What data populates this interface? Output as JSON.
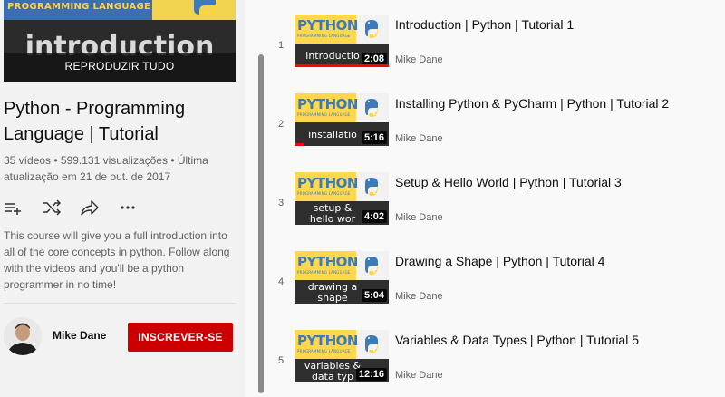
{
  "playlist": {
    "hero_band_text": "PROGRAMMING LANGUAGE",
    "hero_word": "introduction",
    "play_all_label": "REPRODUZIR TUDO",
    "title": "Python - Programming Language | Tutorial",
    "stats": "35 vídeos • 599.131 visualizações • Última atualização em 21 de out. de 2017",
    "description": "This course will give you a full introduction into all of the core concepts in python. Follow along with the videos and you'll be a python programmer in no time!",
    "actions": [
      "add-to-queue",
      "shuffle",
      "share",
      "more"
    ]
  },
  "channel": {
    "name": "Mike Dane",
    "subscribe_label": "INSCREVER-SE"
  },
  "thumb_brand": {
    "python": "PYTHON",
    "sub": "PROGRAMMING LANGUAGE"
  },
  "videos": [
    {
      "index": "1",
      "title": "Introduction | Python | Tutorial 1",
      "channel": "Mike Dane",
      "duration": "2:08",
      "caption": "introductio",
      "watched": 1.0
    },
    {
      "index": "2",
      "title": "Installing Python & PyCharm | Python | Tutorial 2",
      "channel": "Mike Dane",
      "duration": "5:16",
      "caption": "installatio",
      "watched": 0.1
    },
    {
      "index": "3",
      "title": "Setup & Hello World | Python | Tutorial 3",
      "channel": "Mike Dane",
      "duration": "4:02",
      "caption": "setup &\nhello wor",
      "watched": 0
    },
    {
      "index": "4",
      "title": "Drawing a Shape | Python | Tutorial 4",
      "channel": "Mike Dane",
      "duration": "5:04",
      "caption": "drawing a\nshape",
      "watched": 0
    },
    {
      "index": "5",
      "title": "Variables & Data Types | Python | Tutorial 5",
      "channel": "Mike Dane",
      "duration": "12:16",
      "caption": "variables &\ndata typ",
      "watched": 0
    }
  ],
  "colors": {
    "accent_red": "#cc0000",
    "python_blue": "#3d7ab8",
    "python_yellow": "#ffd84d"
  }
}
